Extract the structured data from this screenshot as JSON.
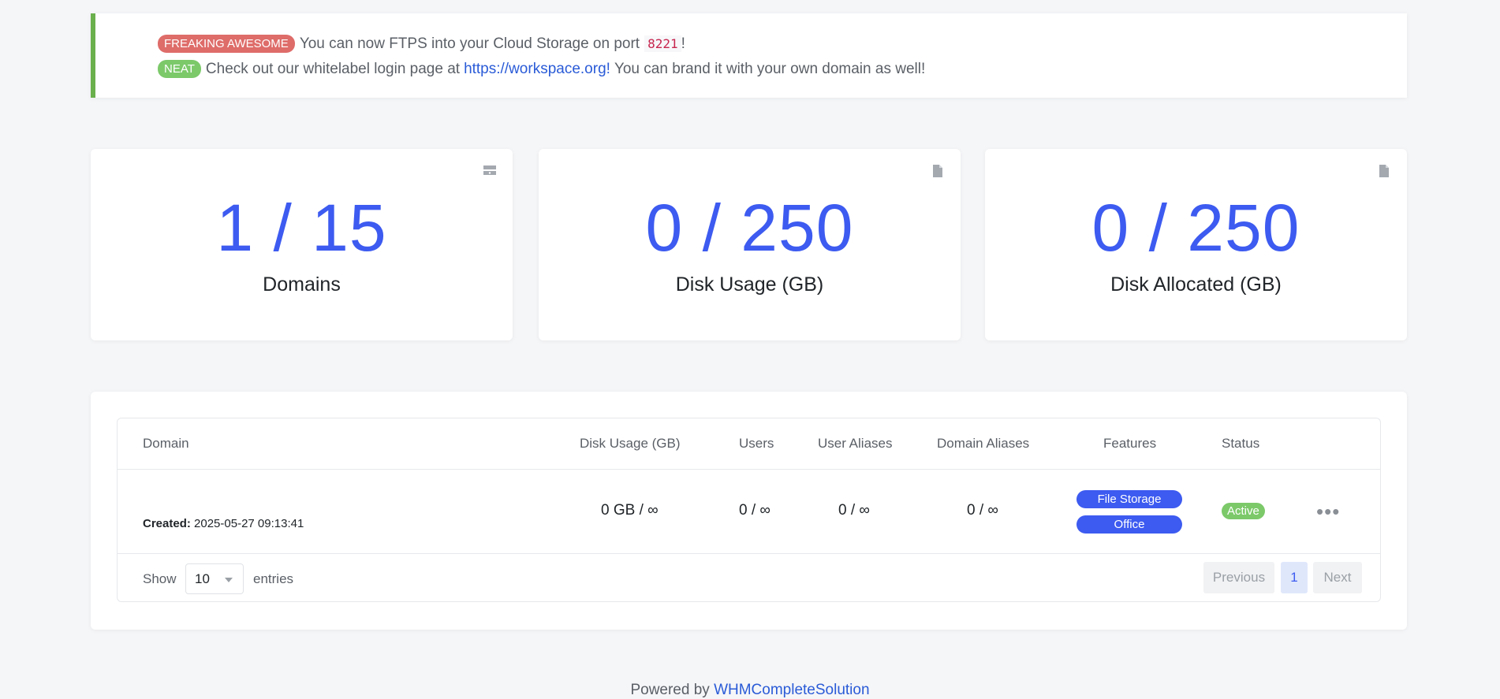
{
  "notice": {
    "line1": {
      "badge": "FREAKING AWESOME",
      "text": "You can now FTPS into your Cloud Storage on port",
      "code": "8221",
      "suffix": "!"
    },
    "line2": {
      "badge": "NEAT",
      "text": "Check out our whitelabel login page at",
      "link": "https://workspace.org!",
      "suffix": "You can brand it with your own domain as well!"
    }
  },
  "stats": [
    {
      "value": "1 / 15",
      "label": "Domains",
      "icon": "server-icon"
    },
    {
      "value": "0 / 250",
      "label": "Disk Usage (GB)",
      "icon": "file-icon"
    },
    {
      "value": "0 / 250",
      "label": "Disk Allocated (GB)",
      "icon": "file-icon"
    }
  ],
  "table": {
    "headers": {
      "domain": "Domain",
      "disk": "Disk Usage (GB)",
      "users": "Users",
      "user_aliases": "User Aliases",
      "domain_aliases": "Domain Aliases",
      "features": "Features",
      "status": "Status"
    },
    "rows": [
      {
        "created_label": "Created:",
        "created": "2025-05-27 09:13:41",
        "disk": "0 GB / ∞",
        "users": "0 / ∞",
        "user_aliases": "0 / ∞",
        "domain_aliases": "0 / ∞",
        "features": [
          "File Storage",
          "Office"
        ],
        "status": "Active",
        "actions_icon": "more-icon"
      }
    ]
  },
  "pagination": {
    "show": "Show",
    "page_size": "10",
    "entries": "entries",
    "previous": "Previous",
    "current": "1",
    "next": "Next"
  },
  "footer": {
    "powered_by": "Powered by",
    "link": "WHMCompleteSolution"
  },
  "colors": {
    "accent": "#3d5bf0",
    "success": "#7cc96a",
    "danger": "#d9534f"
  }
}
